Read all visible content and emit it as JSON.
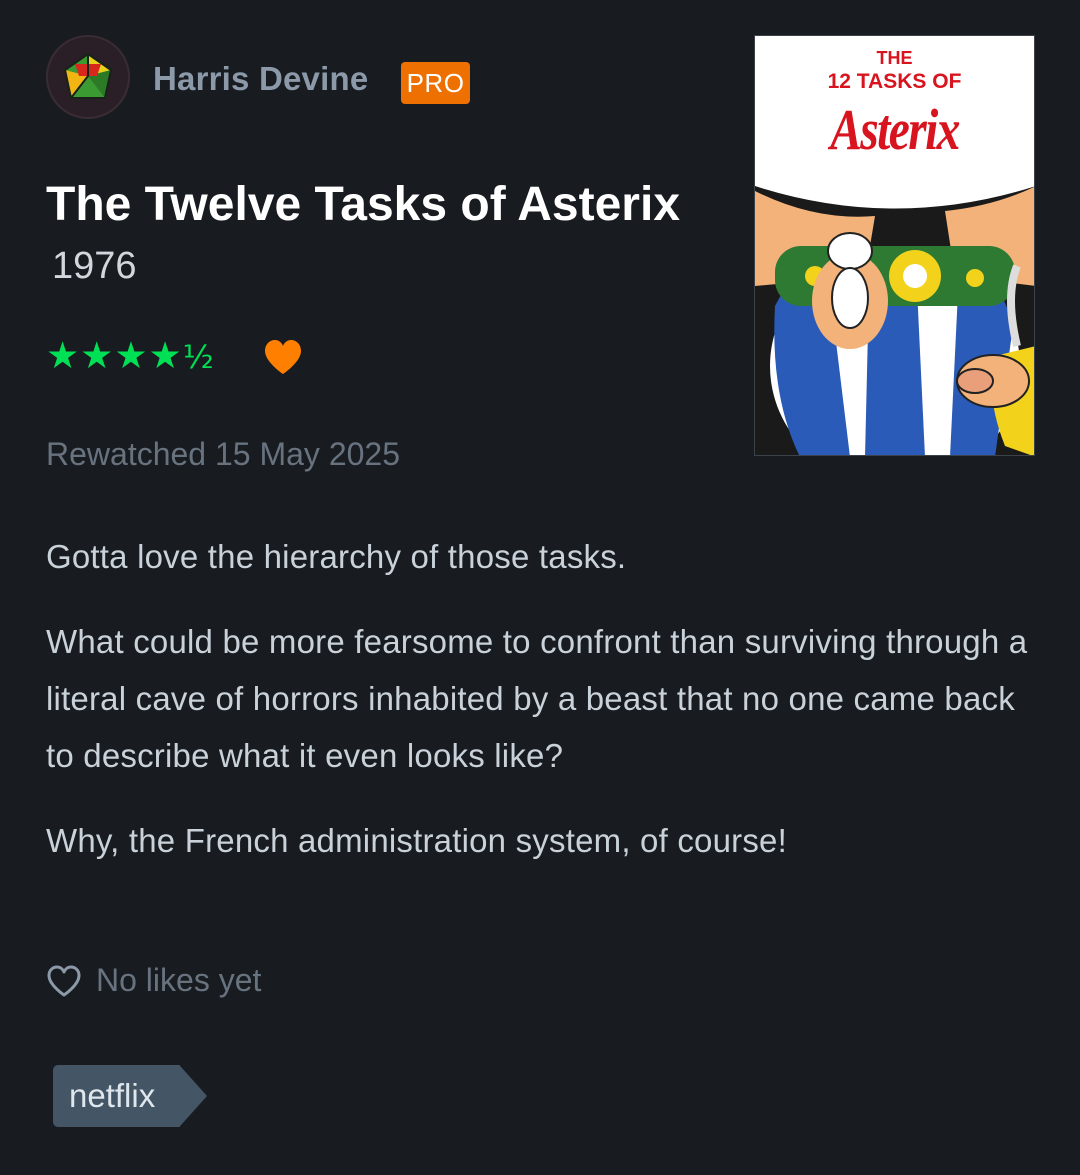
{
  "reviewer": {
    "name": "Harris Devine",
    "badge": "PRO"
  },
  "film": {
    "title": "The Twelve Tasks of Asterix",
    "year": "1976",
    "poster": {
      "line1": "THE",
      "line2": "12 TASKS OF",
      "line3": "Asterix"
    }
  },
  "rating": {
    "stars": "★★★★",
    "half": "½",
    "value": 4.5,
    "max": 5,
    "liked": true,
    "star_color": "#00e054",
    "heart_color": "#ff8000"
  },
  "watch_info": "Rewatched 15 May 2025",
  "review": {
    "paragraphs": [
      "Gotta love the hierarchy of those tasks.",
      "What could be more fearsome to confront than surviving through a literal cave of horrors inhabited by a beast that no one came back to describe what it even looks like?",
      "Why, the French administration system, of course!"
    ]
  },
  "likes": {
    "icon": "heart-outline-icon",
    "label": "No likes yet"
  },
  "tags": [
    "netflix"
  ],
  "colors": {
    "background": "#181c21",
    "pro_badge": "#ee7000",
    "tag_background": "#445566"
  }
}
